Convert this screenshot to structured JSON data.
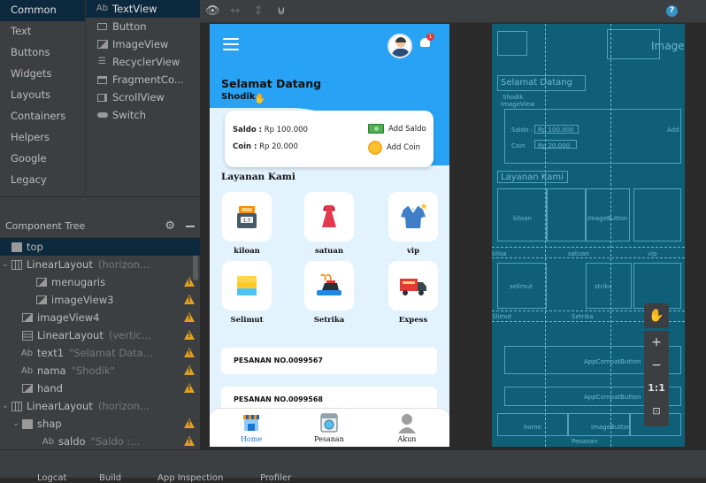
{
  "palette": {
    "categories": [
      "Common",
      "Text",
      "Buttons",
      "Widgets",
      "Layouts",
      "Containers",
      "Helpers",
      "Google",
      "Legacy"
    ],
    "items": [
      {
        "icon": "ab-icon",
        "label": "TextView"
      },
      {
        "icon": "button-icon",
        "label": "Button"
      },
      {
        "icon": "image-icon",
        "label": "ImageView"
      },
      {
        "icon": "list-icon",
        "label": "RecyclerView"
      },
      {
        "icon": "fragment-icon",
        "label": "FragmentCo..."
      },
      {
        "icon": "scroll-icon",
        "label": "ScrollView"
      },
      {
        "icon": "switch-icon",
        "label": "Switch"
      }
    ]
  },
  "tree": {
    "title": "Component Tree",
    "rows": [
      {
        "name": "top",
        "detail": "",
        "icon": "top"
      },
      {
        "name": "LinearLayout",
        "detail": "(horizon...",
        "icon": "ll"
      },
      {
        "name": "menugaris",
        "detail": "",
        "icon": "img"
      },
      {
        "name": "imageView3",
        "detail": "",
        "icon": "img"
      },
      {
        "name": "imageView4",
        "detail": "",
        "icon": "img"
      },
      {
        "name": "LinearLayout",
        "detail": "(vertic...",
        "icon": "llv"
      },
      {
        "name": "text1",
        "detail": "\"Selamat Data...",
        "icon": "ab"
      },
      {
        "name": "nama",
        "detail": "\"Shodik\"",
        "icon": "ab"
      },
      {
        "name": "hand",
        "detail": "",
        "icon": "img"
      },
      {
        "name": "LinearLayout",
        "detail": "(horizon...",
        "icon": "ll"
      },
      {
        "name": "shap",
        "detail": "",
        "icon": "top"
      },
      {
        "name": "saldo",
        "detail": "\"Saldo :...",
        "icon": "ab"
      }
    ]
  },
  "bottom_bar": [
    "Logcat",
    "Build",
    "App Inspection",
    "Profiler"
  ],
  "app": {
    "greeting": "Selamat Datang",
    "username": "Shodik",
    "badge": "1",
    "saldo_label": "Saldo :",
    "saldo_value": "Rp 100.000",
    "coin_label": "Coin :",
    "coin_value": "Rp 20.000",
    "add_saldo": "Add Saldo",
    "add_coin": "Add Coin",
    "services_title": "Layanan Kami",
    "services": [
      "kiloan",
      "satuan",
      "vip",
      "Selimut",
      "Setrika",
      "Expess"
    ],
    "scale_text": "1.7",
    "orders": [
      "PESANAN NO.0099567",
      "PESANAN NO.0099568"
    ],
    "nav": [
      "Home",
      "Pesanan",
      "Akun"
    ]
  },
  "blueprint": {
    "image": "Image",
    "greeting": "Selamat Datang",
    "name": "Shodik",
    "image_view": "ImageView",
    "saldo": "Saldo :",
    "saldo_val": "Rp 100.000",
    "coin": "Coin",
    "coin_val": "Rp 20.000",
    "add": "Add",
    "layanan": "Layanan Kami",
    "kiloan": "kiloan",
    "image_button": "ImageButton",
    "labels_row1": [
      "kiloa",
      "satuan",
      "vip"
    ],
    "selimut": "selimut",
    "strika": "strika",
    "labels_row2": [
      "Slimut",
      "Setrika"
    ],
    "appcompat": "AppCompatButton",
    "home": "home",
    "image_button2": "ImageButton",
    "pesanan": "Pesanan"
  },
  "zoom": {
    "ratio": "1:1"
  }
}
